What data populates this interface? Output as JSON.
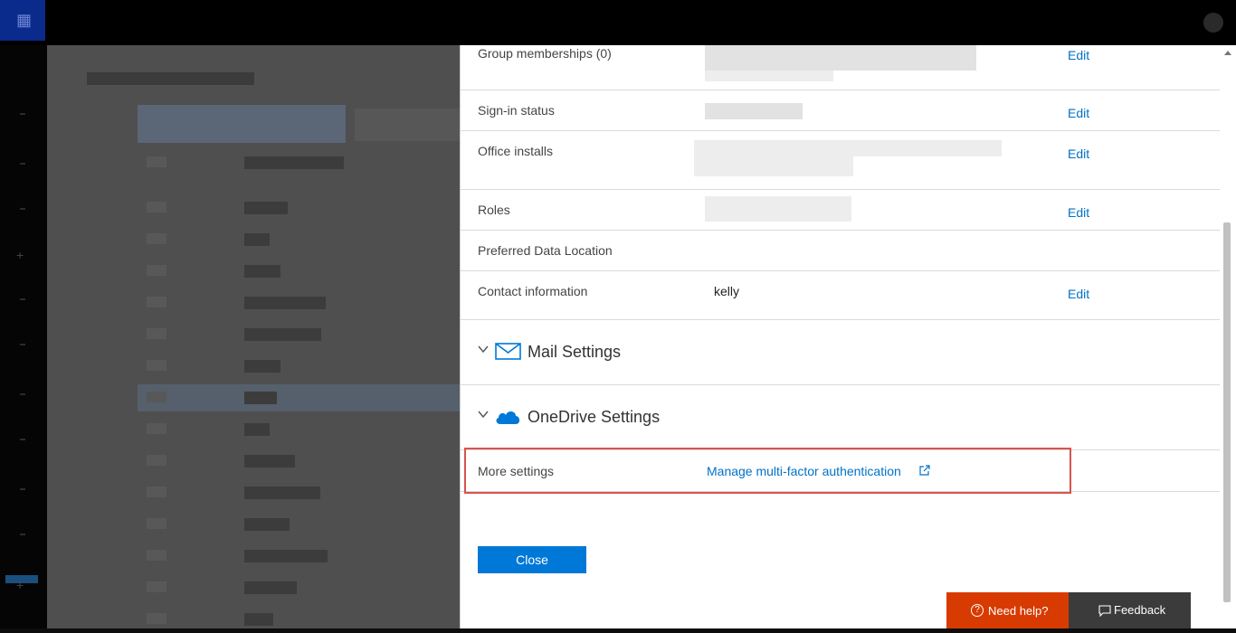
{
  "panel": {
    "rows": [
      {
        "label": "Group memberships (0)",
        "edit": "Edit"
      },
      {
        "label": "Sign-in status",
        "edit": "Edit"
      },
      {
        "label": "Office installs",
        "edit": "Edit"
      },
      {
        "label": "Roles",
        "edit": "Edit"
      },
      {
        "label": "Preferred Data Location"
      },
      {
        "label": "Contact information",
        "value": "kelly",
        "edit": "Edit"
      }
    ],
    "sections": [
      {
        "title": "Mail Settings",
        "icon": "mail-icon"
      },
      {
        "title": "OneDrive Settings",
        "icon": "onedrive-cloud-icon"
      }
    ],
    "more_settings": {
      "label": "More settings",
      "link": "Manage multi-factor authentication",
      "icon": "external-link-icon"
    },
    "close_label": "Close"
  },
  "footer": {
    "help_label": "Need help?",
    "feedback_label": "Feedback"
  },
  "colors": {
    "link": "#0072c6",
    "close_button": "#0078d7",
    "help_button": "#d83b01",
    "feedback_button": "#3b3b3b",
    "highlight_border": "#d9534f"
  }
}
